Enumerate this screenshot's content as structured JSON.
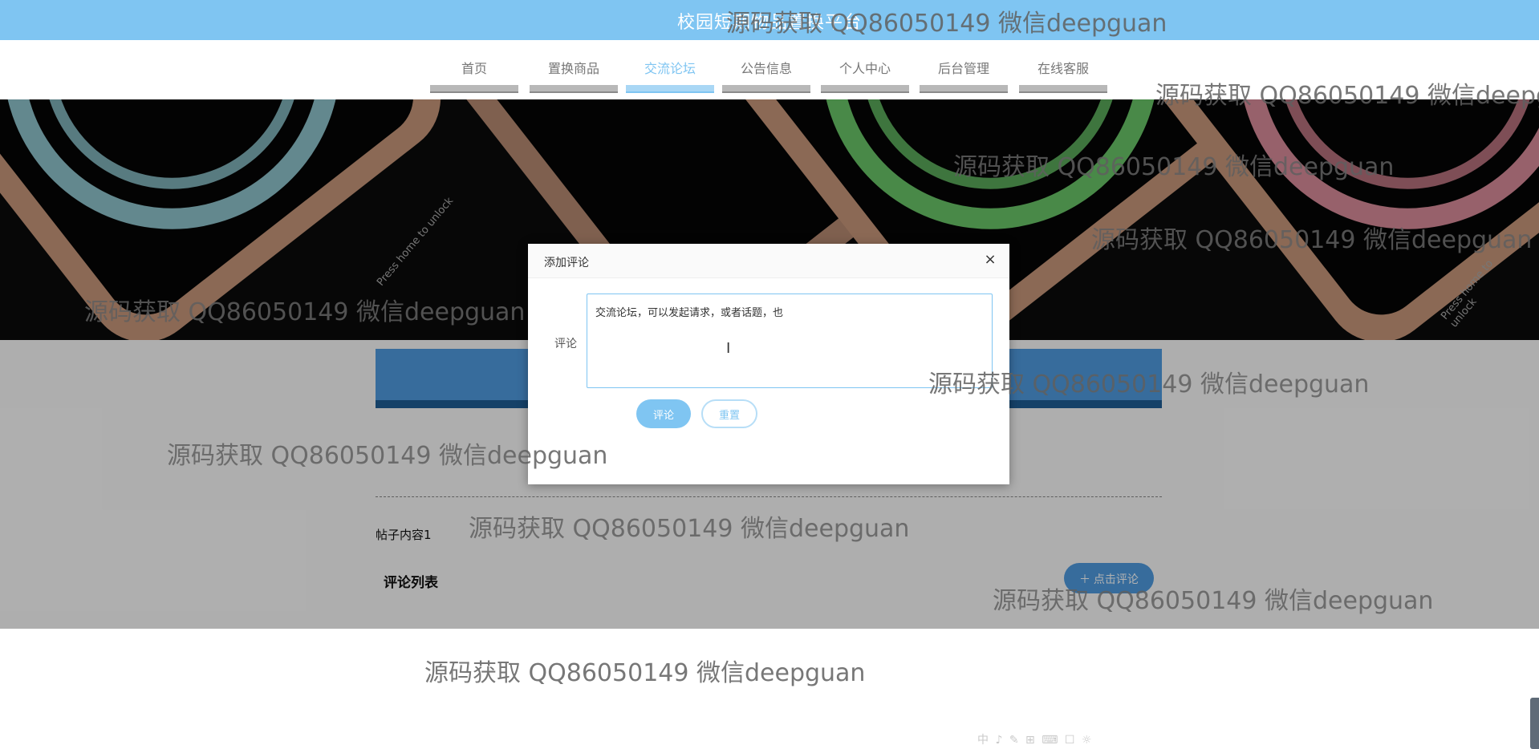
{
  "header": {
    "site_title": "校园短期物品置换平台"
  },
  "nav": {
    "items": [
      {
        "label": "首页"
      },
      {
        "label": "置换商品"
      },
      {
        "label": "交流论坛"
      },
      {
        "label": "公告信息"
      },
      {
        "label": "个人中心"
      },
      {
        "label": "后台管理"
      },
      {
        "label": "在线客服"
      }
    ],
    "active_index": 2
  },
  "banner": {
    "left_phone_text": "Press home to unlock",
    "right_phone_text": "Press home to unlock"
  },
  "page": {
    "post_content": "帖子内容1",
    "comment_list_title": "评论列表",
    "add_comment_button": "＋ 点击评论"
  },
  "dialog": {
    "title": "添加评论",
    "field_label": "评论",
    "textarea_value": "交流论坛，可以发起请求，或者话题，也",
    "submit_label": "评论",
    "reset_label": "重置",
    "close_icon": "×"
  },
  "watermark": {
    "text": "源码获取 QQ86050149 微信deepguan"
  },
  "tray": {
    "icons_text": "中 ♪ ✎ ⊞ ⌨ ☐ ☼"
  },
  "colors": {
    "accent": "#7fc5f2",
    "topbar": "#7fc5f2",
    "dark_blue": "#1f5d96"
  }
}
